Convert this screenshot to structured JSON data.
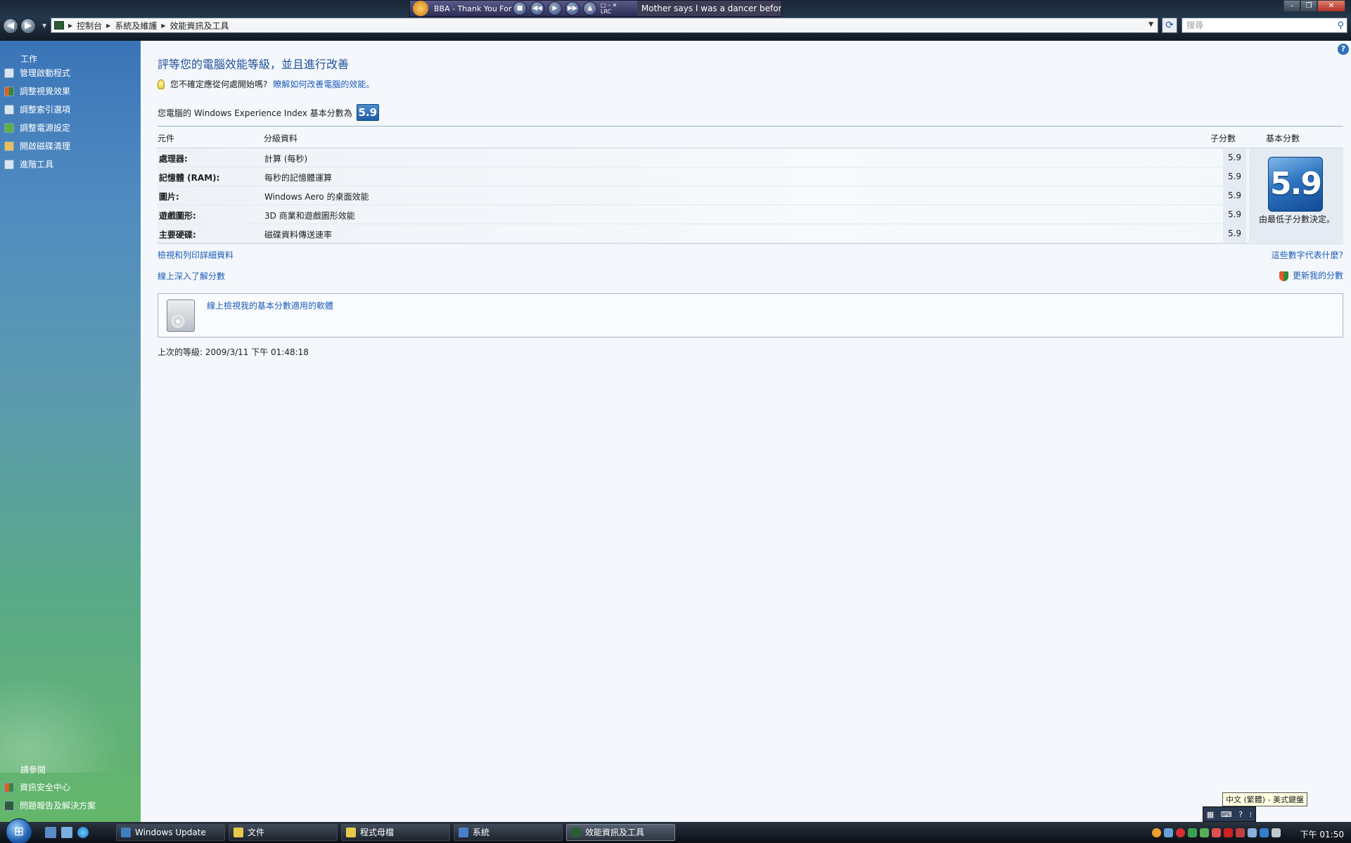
{
  "window": {
    "breadcrumb": [
      "控制台",
      "系統及維護",
      "效能資訊及工具"
    ],
    "search_placeholder": "搜尋"
  },
  "media_player": {
    "song_title": "BBA - Thank You For Th",
    "lrc_label": "LRC",
    "lyric": "Mother says I was a dancer before"
  },
  "sidebar": {
    "tasks_heading": "工作",
    "tasks": [
      {
        "label": "管理啟動程式",
        "icon": "programs-icon"
      },
      {
        "label": "調整視覺效果",
        "icon": "shield-icon"
      },
      {
        "label": "調整索引選項",
        "icon": "index-icon"
      },
      {
        "label": "調整電源設定",
        "icon": "power-icon"
      },
      {
        "label": "開啟磁碟清理",
        "icon": "disk-cleanup-icon"
      },
      {
        "label": "進階工具",
        "icon": "advanced-tools-icon"
      }
    ],
    "see_also_heading": "請參閱",
    "see_also": [
      {
        "label": "資訊安全中心",
        "icon": "security-center-icon"
      },
      {
        "label": "問題報告及解決方案",
        "icon": "problem-reports-icon"
      }
    ]
  },
  "main": {
    "title": "評等您的電腦效能等級，並且進行改善",
    "tip_text": "您不確定應從何處開始嗎?",
    "tip_link": "瞭解如何改善電腦的效能。",
    "index_text": "您電腦的 Windows Experience Index 基本分數為",
    "base_score": "5.9",
    "columns": {
      "component": "元件",
      "details": "分級資料",
      "subscore": "子分數",
      "base": "基本分數"
    },
    "rows": [
      {
        "component": "處理器:",
        "details": "計算 (每秒)",
        "subscore": "5.9"
      },
      {
        "component": "記憶體 (RAM):",
        "details": "每秒的記憶體運算",
        "subscore": "5.9"
      },
      {
        "component": "圖片:",
        "details": "Windows Aero 的桌面效能",
        "subscore": "5.9"
      },
      {
        "component": "遊戲圖形:",
        "details": "3D 商業和遊戲圖形效能",
        "subscore": "5.9"
      },
      {
        "component": "主要硬碟:",
        "details": "磁碟資料傳送速率",
        "subscore": "5.9"
      }
    ],
    "base_caption": "由最低子分數決定。",
    "link_print": "檢視和列印詳細資料",
    "link_learn": "線上深入了解分數",
    "link_meaning": "這些數字代表什麼?",
    "link_update": "更新我的分數",
    "software_link": "線上檢視我的基本分數適用的軟體",
    "last_rated": "上次的等級: 2009/3/11 下午 01:48:18"
  },
  "ime": {
    "tooltip": "中文 (繁體) - 美式鍵盤"
  },
  "taskbar": {
    "buttons": [
      {
        "label": "Windows Update",
        "color": "#3f7fbf"
      },
      {
        "label": "文件",
        "color": "#e8c84a"
      },
      {
        "label": "程式母檔",
        "color": "#e8c84a"
      },
      {
        "label": "系統",
        "color": "#4a7fc8"
      },
      {
        "label": "效能資訊及工具",
        "color": "#2d5d35",
        "active": true
      }
    ],
    "clock": "下午 01:50"
  }
}
